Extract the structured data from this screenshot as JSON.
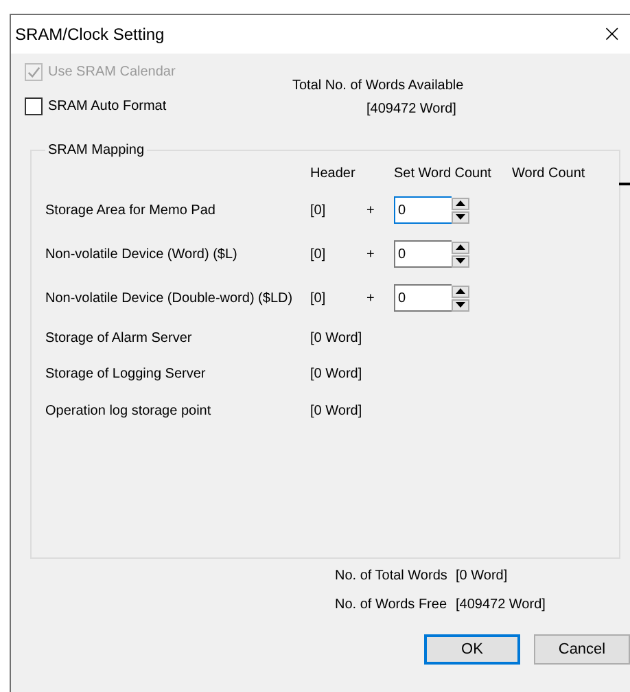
{
  "window": {
    "title": "SRAM/Clock Setting",
    "close": "×"
  },
  "options": [
    {
      "label": "Use SRAM Calendar",
      "checked": true,
      "disabled": true
    },
    {
      "label": "SRAM Auto Format",
      "checked": false,
      "disabled": false
    }
  ],
  "total_available": {
    "label": "Total No. of Words Available",
    "value": "[409472 Word]"
  },
  "mapping": {
    "title": "SRAM Mapping",
    "columns": [
      "Header",
      "Set Word Count",
      "Word Count"
    ],
    "rows": [
      {
        "kind": "spinner",
        "label": "Storage Area for Memo Pad",
        "header": "[0]",
        "plus": "+",
        "value": "0",
        "focused": true
      },
      {
        "kind": "spinner",
        "label": "Non-volatile Device (Word) ($L)",
        "header": "[0]",
        "plus": "+",
        "value": "0",
        "focused": false
      },
      {
        "kind": "spinner",
        "label": "Non-volatile Device (Double-word) ($LD)",
        "header": "[0]",
        "plus": "+",
        "value": "0",
        "focused": false
      },
      {
        "kind": "fixed",
        "label": "Storage of Alarm Server",
        "header": "[0 Word]"
      },
      {
        "kind": "fixed",
        "label": "Storage of Logging Server",
        "header": "[0 Word]"
      },
      {
        "kind": "fixed",
        "label": "Operation log storage point",
        "header": "[0 Word]"
      }
    ]
  },
  "summary": [
    {
      "label": "No. of Total Words",
      "value": "[0 Word]"
    },
    {
      "label": "No. of Words Free",
      "value": "[409472 Word]"
    }
  ],
  "buttons": [
    {
      "label": "OK",
      "default": true
    },
    {
      "label": "Cancel",
      "default": false
    }
  ]
}
